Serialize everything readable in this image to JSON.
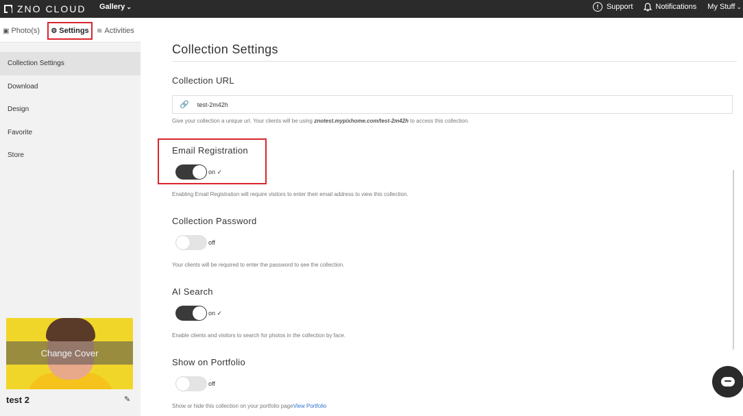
{
  "topbar": {
    "brand": "ZNO CLOUD",
    "gallery_menu": "Gallery",
    "support": "Support",
    "notifications": "Notifications",
    "my_stuff": "My Stuff"
  },
  "sidebar": {
    "tabs": [
      {
        "label": "Photo(s)",
        "icon": "image-icon"
      },
      {
        "label": "Settings",
        "icon": "gear-icon"
      },
      {
        "label": "Activities",
        "icon": "rss-icon"
      }
    ],
    "items": [
      {
        "label": "Collection Settings"
      },
      {
        "label": "Download"
      },
      {
        "label": "Design"
      },
      {
        "label": "Favorite"
      },
      {
        "label": "Store"
      }
    ],
    "cover_button": "Change Cover",
    "collection_name": "test 2"
  },
  "main": {
    "title": "Collection Settings",
    "url_section": {
      "title": "Collection URL",
      "value": "test-2m42h",
      "help_prefix": "Give your collection a unique url. Your clients will be using ",
      "help_url": "znotest.mypixhome.com/test-2m42h",
      "help_suffix": " to access this collection."
    },
    "email_registration": {
      "title": "Email Registration",
      "state": "on ✓",
      "help": "Enabling Email Registration will require visitors to enter their email address to view this collection."
    },
    "password": {
      "title": "Collection Password",
      "state": "off",
      "help": "Your clients will be required to enter the password to see the collection."
    },
    "ai_search": {
      "title": "AI Search",
      "state": "on ✓",
      "help": "Enable clients and visitors to search for photos in the collection by face."
    },
    "portfolio": {
      "title": "Show on Portfolio",
      "state": "off",
      "help": "Show or hide this collection on your portfolio page",
      "link": "View Portfolio"
    }
  },
  "colors": {
    "topbar": "#2b2b2b",
    "highlight": "#d9242c",
    "toggle_on": "#3a3a3a",
    "toggle_off": "#e4e4e4",
    "link": "#2a6fcf"
  }
}
